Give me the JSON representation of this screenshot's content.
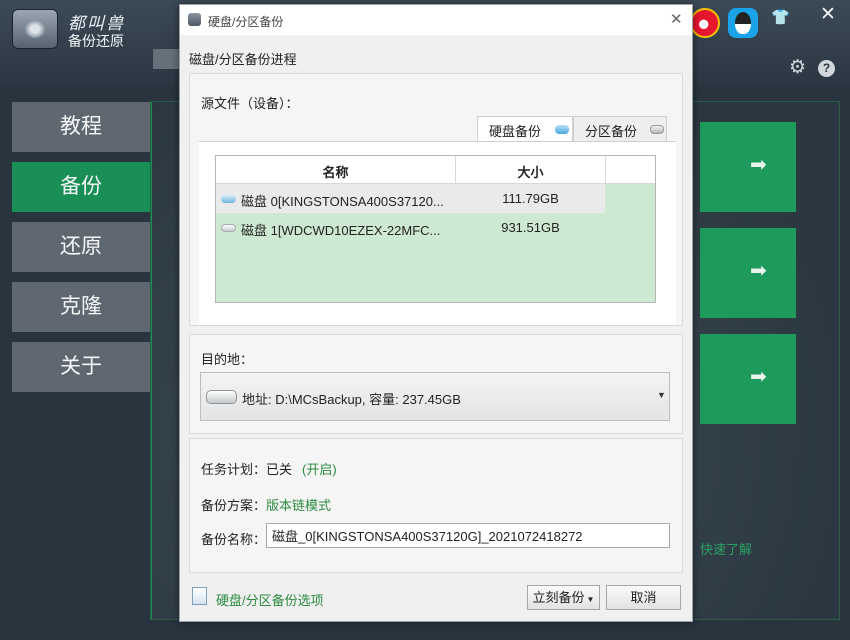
{
  "app": {
    "brand_cursive": "都叫兽",
    "brand_name": "备份还原",
    "nav": [
      {
        "label": "教程"
      },
      {
        "label": "备份"
      },
      {
        "label": "还原"
      },
      {
        "label": "克隆"
      },
      {
        "label": "关于"
      }
    ],
    "active_nav": "备份",
    "quick_learn": "快速了解",
    "icons": {
      "weibo": "weibo-icon",
      "qq": "qq-icon",
      "skin": "skin-icon",
      "close": "close-icon",
      "settings": "gear-icon",
      "help": "help-icon"
    },
    "help_glyph": "?"
  },
  "dialog": {
    "title": "硬盘/分区备份",
    "heading": "磁盘/分区备份进程",
    "source": {
      "label": "源文件（设备）：",
      "tabs": [
        {
          "label": "硬盘备份",
          "selected": true
        },
        {
          "label": "分区备份",
          "selected": false
        }
      ],
      "table": {
        "columns": [
          "名称",
          "大小"
        ],
        "rows": [
          {
            "name": "磁盘 0[KINGSTONSA400S37120...",
            "size": "111.79GB",
            "selected": true
          },
          {
            "name": "磁盘 1[WDCWD10EZEX-22MFC...",
            "size": "931.51GB",
            "selected": false
          }
        ]
      }
    },
    "destination": {
      "label": "目的地：",
      "value": "地址: D:\\MCsBackup, 容量: 237.45GB"
    },
    "task": {
      "schedule_label": "任务计划：",
      "schedule_state": "已关",
      "schedule_open": "(开启)",
      "scheme_label": "备份方案：",
      "scheme_value": "版本链模式",
      "name_label": "备份名称：",
      "name_value": "磁盘_0[KINGSTONSA400S37120G]_2021072418272"
    },
    "footer": {
      "options_link": "硬盘/分区备份选项",
      "backup_button": "立刻备份",
      "cancel_button": "取消"
    }
  },
  "colors": {
    "accent_green": "#198f56",
    "link_green": "#2a8a3e",
    "table_selection": "#cde9d2"
  }
}
